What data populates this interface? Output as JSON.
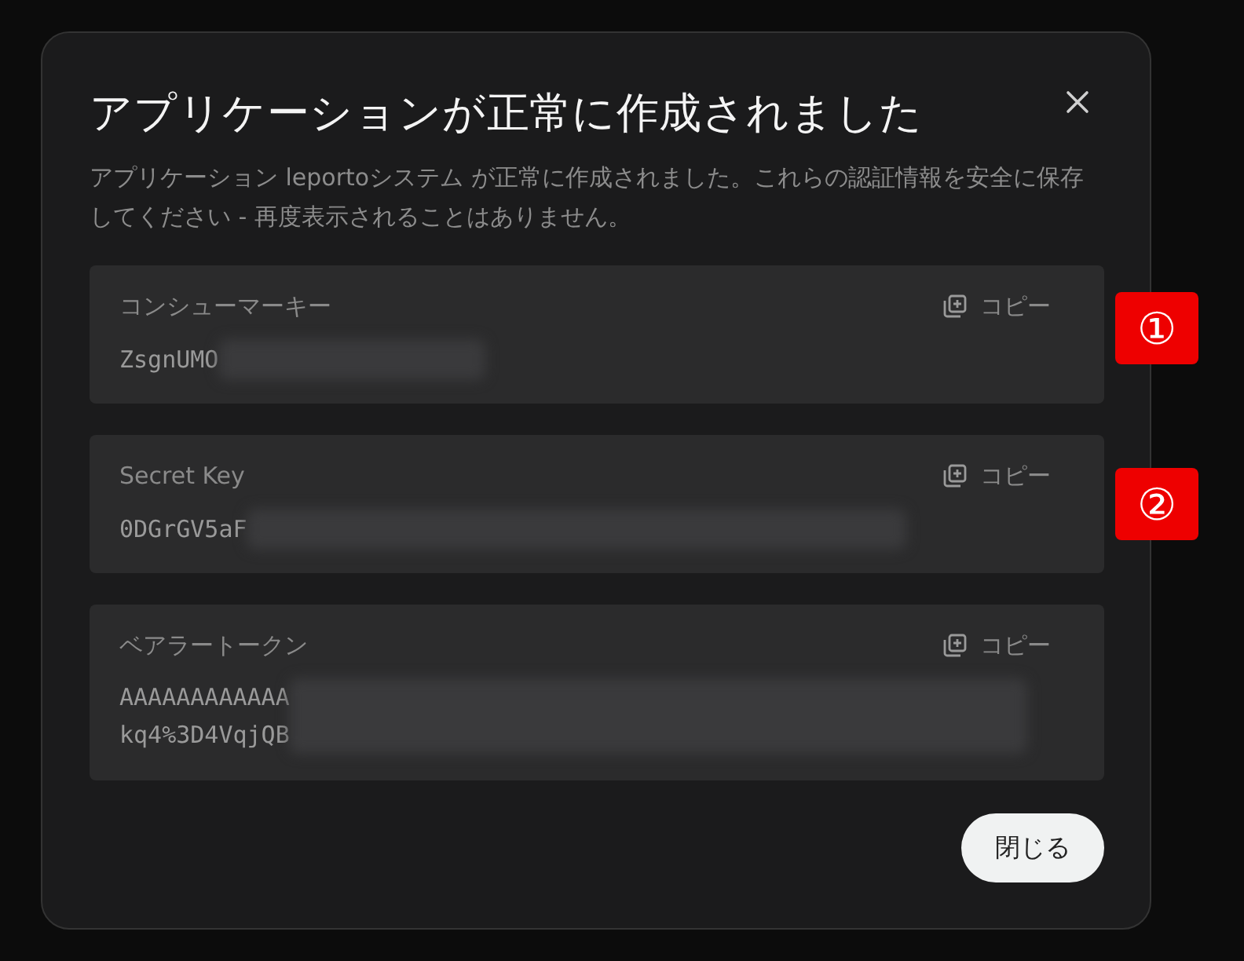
{
  "dialog": {
    "title": "アプリケーションが正常に作成されました",
    "description": "アプリケーション leportoシステム が正常に作成されました。これらの認証情報を安全に保存してください - 再度表示されることはありません。"
  },
  "credentials": [
    {
      "label": "コンシューマーキー",
      "copy_label": "コピー",
      "value_lines": [
        "ZsgnUMO"
      ],
      "redacted": true,
      "annotation": "①"
    },
    {
      "label": "Secret Key",
      "copy_label": "コピー",
      "value_lines": [
        "0DGrGV5aF"
      ],
      "redacted": true,
      "annotation": "②"
    },
    {
      "label": "ベアラートークン",
      "copy_label": "コピー",
      "value_lines": [
        "AAAAAAAAAAAA",
        "kq4%3D4VqjQB"
      ],
      "redacted": true
    }
  ],
  "close_button": "閉じる"
}
